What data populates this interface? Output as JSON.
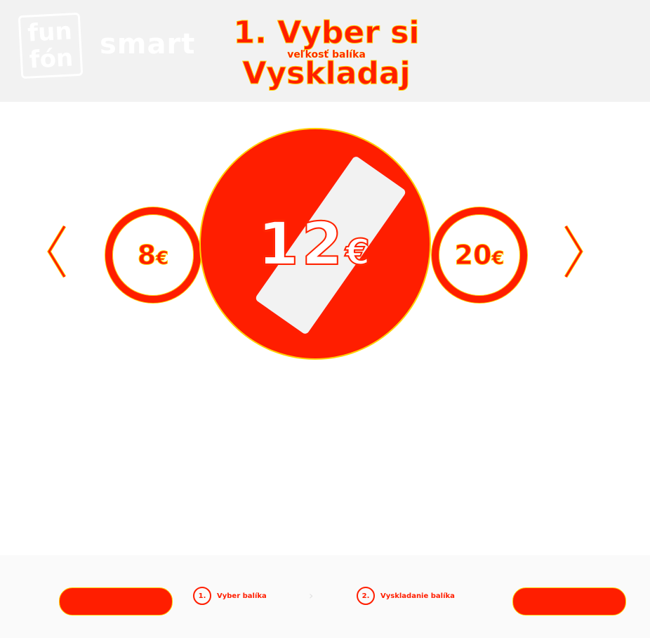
{
  "header": {
    "brand_logo_line1": "fun",
    "brand_logo_line2": "fón",
    "brand_word": "smart",
    "title": "1. Vyber si Vyskladaj",
    "subtitle": "veľkosť balíka"
  },
  "carousel": {
    "prev_label": "‹",
    "next_label": "›",
    "options": [
      {
        "amount": "8",
        "currency": "€"
      },
      {
        "amount": "12",
        "currency": "€"
      },
      {
        "amount": "20",
        "currency": "€"
      }
    ],
    "selected_index": 1
  },
  "footer": {
    "back_button": "",
    "next_button": "",
    "steps": [
      {
        "num": "1.",
        "label": "Vyber balíka"
      },
      {
        "num": "2.",
        "label": "Vyskladanie balíka"
      }
    ],
    "separator": "›"
  },
  "colors": {
    "accent": "#ff1e00",
    "outline": "#ffd000",
    "header_bg": "#f2f2f2"
  }
}
